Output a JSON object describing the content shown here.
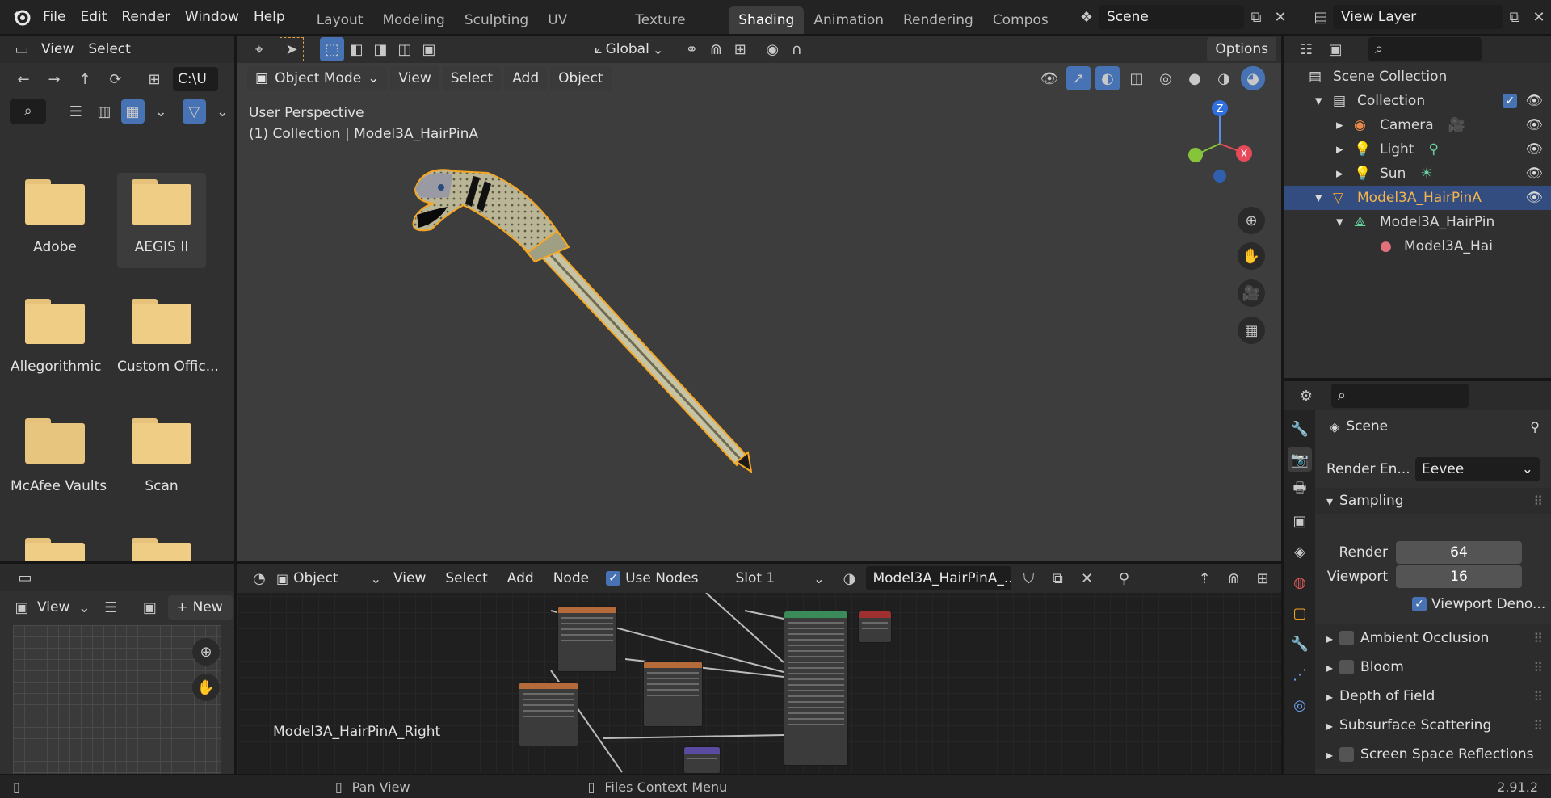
{
  "menu": [
    "File",
    "Edit",
    "Render",
    "Window",
    "Help"
  ],
  "workspaces": [
    "Layout",
    "Modeling",
    "Sculpting",
    "UV Editing",
    "Texture Paint",
    "Shading",
    "Animation",
    "Rendering",
    "Compos"
  ],
  "active_workspace": "Shading",
  "scene": {
    "name": "Scene"
  },
  "view_layer": {
    "name": "View Layer"
  },
  "file_browser": {
    "menus": [
      "View",
      "Select"
    ],
    "path": "C:\\U",
    "folders": [
      "Adobe",
      "AEGIS II",
      "Allegorithmic",
      "Custom Offic...",
      "McAfee Vaults",
      "Scan"
    ]
  },
  "viewport": {
    "mode": "Object Mode",
    "menus": [
      "View",
      "Select",
      "Add",
      "Object"
    ],
    "orientation": "Global",
    "options_label": "Options",
    "overlay_line1": "User Perspective",
    "overlay_line2": "(1) Collection | Model3A_HairPinA",
    "gizmo": {
      "z": "Z",
      "x": "X"
    }
  },
  "image_editor": {
    "view_label": "View",
    "new_label": "New"
  },
  "node_editor": {
    "object_label": "Object",
    "menus": [
      "View",
      "Select",
      "Add",
      "Node"
    ],
    "use_nodes_label": "Use Nodes",
    "slot": "Slot 1",
    "material": "Model3A_HairPinA_...",
    "material_name_label": "Model3A_HairPinA_Right"
  },
  "outliner": {
    "rows": [
      {
        "label": "Scene Collection",
        "indent": 0,
        "icon": "scene-collection-icon"
      },
      {
        "label": "Collection",
        "indent": 1,
        "icon": "collection-icon"
      },
      {
        "label": "Camera",
        "indent": 2,
        "icon": "camera-icon"
      },
      {
        "label": "Light",
        "indent": 2,
        "icon": "light-icon"
      },
      {
        "label": "Sun",
        "indent": 2,
        "icon": "sun-icon"
      },
      {
        "label": "Model3A_HairPinA",
        "indent": 1,
        "icon": "mesh-object-icon",
        "selected": true
      },
      {
        "label": "Model3A_HairPin",
        "indent": 2,
        "icon": "mesh-data-icon"
      },
      {
        "label": "Model3A_Hai",
        "indent": 3,
        "icon": "material-icon"
      }
    ]
  },
  "properties": {
    "title": "Scene",
    "render_engine_label": "Render En...",
    "render_engine": "Eevee",
    "sampling_label": "Sampling",
    "render_label": "Render",
    "render_value": "64",
    "viewport_label": "Viewport",
    "viewport_value": "16",
    "viewport_denoise_label": "Viewport Deno...",
    "panels": [
      "Ambient Occlusion",
      "Bloom",
      "Depth of Field",
      "Subsurface Scattering",
      "Screen Space Reflections"
    ]
  },
  "status": {
    "pan": "Pan View",
    "context": "Files Context Menu",
    "version": "2.91.2"
  },
  "colors": {
    "accent": "#4772b3",
    "selection_outline": "#f5a623",
    "folder": "#f0cd84",
    "outliner_selected": "#334d80"
  }
}
